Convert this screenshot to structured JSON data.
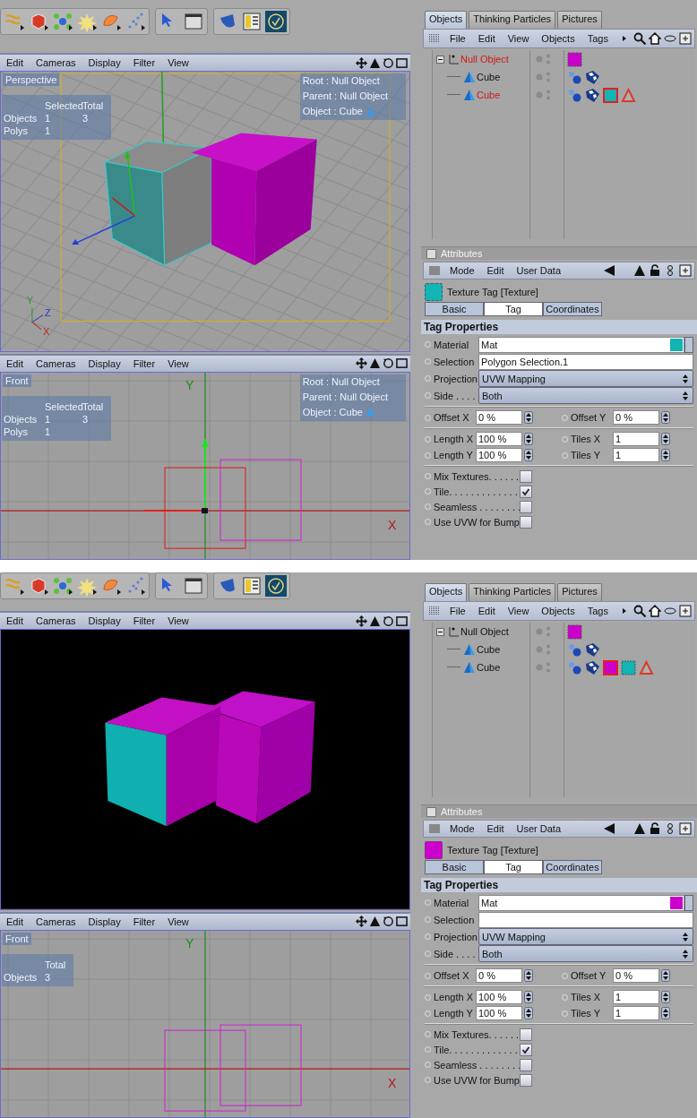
{
  "screens": [
    {
      "viewports": [
        {
          "kind": "perspective",
          "menu": [
            "Edit",
            "Cameras",
            "Display",
            "Filter",
            "View"
          ],
          "view_label": "Perspective",
          "stats": {
            "columns": [
              "Selected",
              "Total"
            ],
            "rows": [
              {
                "label": "Objects",
                "values": [
                  "1",
                  "3"
                ]
              },
              {
                "label": "Polys",
                "values": [
                  "1"
                ]
              }
            ]
          },
          "info": [
            {
              "kind": "root",
              "text": "Root : Null Object"
            },
            {
              "kind": "parent",
              "text": "Parent : Null Object"
            },
            {
              "kind": "object",
              "text": "Object : Cube"
            }
          ],
          "axis_labels": [
            "Y",
            "Z",
            "X"
          ]
        },
        {
          "kind": "front-selected",
          "menu": [
            "Edit",
            "Cameras",
            "Display",
            "Filter",
            "View"
          ],
          "view_label": "Front",
          "stats": {
            "columns": [
              "Selected",
              "Total"
            ],
            "rows": [
              {
                "label": "Objects",
                "values": [
                  "1",
                  "3"
                ]
              },
              {
                "label": "Polys",
                "values": [
                  "1"
                ]
              }
            ]
          },
          "info": [
            {
              "kind": "root",
              "text": "Root : Null Object"
            },
            {
              "kind": "parent",
              "text": "Parent : Null Object"
            },
            {
              "kind": "object",
              "text": "Object : Cube"
            }
          ],
          "axis_labels": [
            "Y",
            "X"
          ]
        }
      ],
      "objects_panel": {
        "tabs": [
          {
            "label": "Objects",
            "selected": true
          },
          {
            "label": "Thinking Particles",
            "selected": false
          },
          {
            "label": "Pictures",
            "selected": false
          }
        ],
        "menu": [
          "File",
          "Edit",
          "View",
          "Objects",
          "Tags"
        ],
        "tree": [
          {
            "kind": "null",
            "name": "Null Object",
            "selected": true,
            "expanded": true,
            "tags": [
              {
                "kind": "texture",
                "color": "#cc00cc",
                "selected": false
              }
            ],
            "children": [
              {
                "kind": "polygon",
                "name": "Cube",
                "selected": false,
                "tags": [
                  {
                    "kind": "phong",
                    "selected": false
                  },
                  {
                    "kind": "uvw",
                    "selected": false
                  }
                ]
              },
              {
                "kind": "polygon",
                "name": "Cube",
                "selected": true,
                "tags": [
                  {
                    "kind": "phong",
                    "selected": false
                  },
                  {
                    "kind": "uvw",
                    "selected": false
                  },
                  {
                    "kind": "texture",
                    "color": "#12b4b4",
                    "selected": true
                  },
                  {
                    "kind": "polyselect",
                    "selected": false
                  }
                ]
              }
            ]
          }
        ]
      },
      "attributes": {
        "title": "Attributes",
        "menu": [
          "Mode",
          "Edit",
          "User Data"
        ],
        "object": {
          "name": "Texture Tag [Texture]",
          "color": "#12b4b4"
        },
        "tabs": [
          {
            "label": "Basic",
            "selected": false
          },
          {
            "label": "Tag",
            "selected": true
          },
          {
            "label": "Coordinates",
            "selected": false
          }
        ],
        "section": "Tag Properties",
        "fields": [
          {
            "kind": "link",
            "label": "Material",
            "value": "Mat",
            "color": "#12b4b4"
          },
          {
            "kind": "text",
            "label": "Selection",
            "value": "Polygon Selection.1"
          },
          {
            "kind": "dropdown",
            "label": "Projection",
            "value": "UVW Mapping"
          },
          {
            "kind": "dropdown",
            "label": "Side . . . .",
            "value": "Both"
          }
        ],
        "number_groups": [
          [
            [
              {
                "label": "Offset X",
                "value": "0 %"
              },
              {
                "label": "Offset Y",
                "value": "0 %"
              }
            ]
          ],
          [
            [
              {
                "label": "Length X",
                "value": "100 %"
              },
              {
                "label": "Tiles X",
                "value": "1"
              }
            ],
            [
              {
                "label": "Length Y",
                "value": "100 %"
              },
              {
                "label": "Tiles Y",
                "value": "1"
              }
            ]
          ]
        ],
        "checkboxes": [
          {
            "label": "Mix Textures. . . . . .",
            "checked": false
          },
          {
            "label": "Tile. . . . . . . . . . . . .",
            "checked": true
          },
          {
            "label": "Seamless . . . . . . . .",
            "checked": false
          },
          {
            "label": "Use UVW for Bump",
            "checked": false
          }
        ]
      }
    },
    {
      "viewports": [
        {
          "kind": "render",
          "menu": [
            "Edit",
            "Cameras",
            "Display",
            "Filter",
            "View"
          ]
        },
        {
          "kind": "front",
          "menu": [
            "Edit",
            "Cameras",
            "Display",
            "Filter",
            "View"
          ],
          "view_label": "Front",
          "stats": {
            "columns": [
              "Total"
            ],
            "rows": [
              {
                "label": "Objects",
                "values": [
                  "3"
                ]
              }
            ]
          },
          "axis_labels": [
            "Y",
            "X"
          ]
        }
      ],
      "objects_panel": {
        "tabs": [
          {
            "label": "Objects",
            "selected": true
          },
          {
            "label": "Thinking Particles",
            "selected": false
          },
          {
            "label": "Pictures",
            "selected": false
          }
        ],
        "menu": [
          "File",
          "Edit",
          "View",
          "Objects",
          "Tags"
        ],
        "tree": [
          {
            "kind": "null",
            "name": "Null Object",
            "selected": false,
            "expanded": true,
            "tags": [
              {
                "kind": "texture",
                "color": "#cc00cc",
                "selected": false
              }
            ],
            "children": [
              {
                "kind": "polygon",
                "name": "Cube",
                "selected": false,
                "tags": [
                  {
                    "kind": "phong",
                    "selected": false
                  },
                  {
                    "kind": "uvw",
                    "selected": false
                  }
                ]
              },
              {
                "kind": "polygon",
                "name": "Cube",
                "selected": false,
                "tags": [
                  {
                    "kind": "phong",
                    "selected": false
                  },
                  {
                    "kind": "uvw",
                    "selected": false
                  },
                  {
                    "kind": "texture",
                    "color": "#cc00cc",
                    "selected": true
                  },
                  {
                    "kind": "texture",
                    "color": "#12b4b4",
                    "selected": false
                  },
                  {
                    "kind": "polyselect",
                    "selected": false
                  }
                ]
              }
            ]
          }
        ]
      },
      "attributes": {
        "title": "Attributes",
        "menu": [
          "Mode",
          "Edit",
          "User Data"
        ],
        "object": {
          "name": "Texture Tag [Texture]",
          "color": "#cc00cc"
        },
        "tabs": [
          {
            "label": "Basic",
            "selected": false
          },
          {
            "label": "Tag",
            "selected": true
          },
          {
            "label": "Coordinates",
            "selected": false
          }
        ],
        "section": "Tag Properties",
        "fields": [
          {
            "kind": "link",
            "label": "Material",
            "value": "Mat",
            "color": "#cc00cc"
          },
          {
            "kind": "text",
            "label": "Selection"
          },
          {
            "kind": "dropdown",
            "label": "Projection",
            "value": "UVW Mapping"
          },
          {
            "kind": "dropdown",
            "label": "Side . . . .",
            "value": "Both"
          }
        ],
        "number_groups": [
          [
            [
              {
                "label": "Offset X",
                "value": "0 %"
              },
              {
                "label": "Offset Y",
                "value": "0 %"
              }
            ]
          ],
          [
            [
              {
                "label": "Length X",
                "value": "100 %"
              },
              {
                "label": "Tiles X",
                "value": "1"
              }
            ],
            [
              {
                "label": "Length Y",
                "value": "100 %"
              },
              {
                "label": "Tiles Y",
                "value": "1"
              }
            ]
          ]
        ],
        "checkboxes": [
          {
            "label": "Mix Textures. . . . . .",
            "checked": false
          },
          {
            "label": "Tile. . . . . . . . . . . . .",
            "checked": true
          },
          {
            "label": "Seamless . . . . . . . .",
            "checked": false
          },
          {
            "label": "Use UVW for Bump",
            "checked": false
          }
        ]
      }
    }
  ]
}
